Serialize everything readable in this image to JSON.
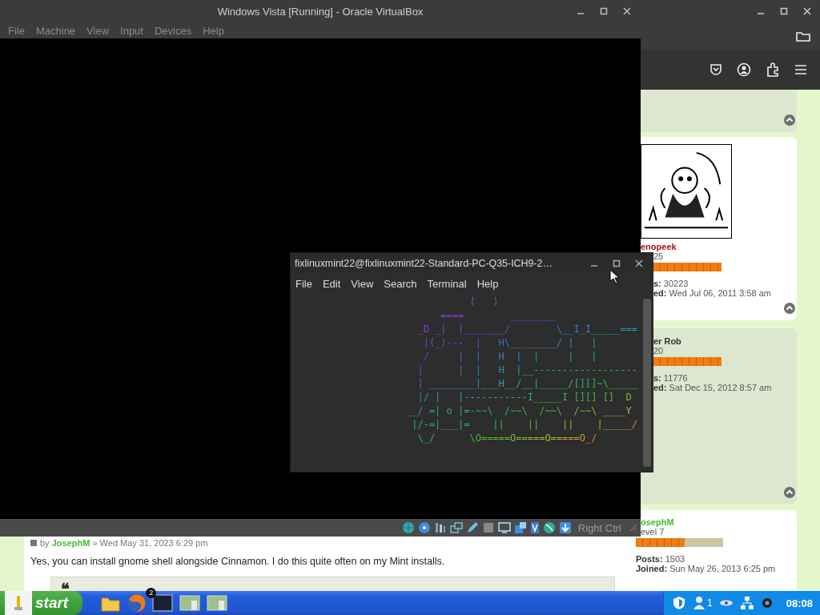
{
  "browser": {
    "profiles": [
      {
        "avatar": true,
        "username": "enopeek",
        "color": "#aa1111",
        "rank": "25",
        "level": 1,
        "posts_label": "s:",
        "posts": "30223",
        "joined_label": "ed:",
        "joined": "Wed Jul 06, 2011 3:58 am"
      },
      {
        "username": "er Rob",
        "color": "#333333",
        "rank": "20",
        "level": 1,
        "posts_label": "s:",
        "posts": "11776",
        "joined_label": "ed:",
        "joined": "Sat Dec 15, 2012 8:57 am"
      },
      {
        "username": "osephM",
        "color": "#44bb33",
        "rank": "evel 7",
        "level": 0.56,
        "posts_label": "Posts:",
        "posts": "1503",
        "joined_label": "Joined:",
        "joined": "Sun May 26, 2013 6:25 pm"
      }
    ],
    "post": {
      "by": "by",
      "author": "JosephM",
      "date": "» Wed May 31, 2023 6:29 pm",
      "text": "Yes, you can install gnome shell alongside Cinnamon. I do this quite often on my Mint installs.",
      "quote_mark": "❝"
    }
  },
  "virtualbox": {
    "title": "Windows Vista [Running] - Oracle VirtualBox",
    "menu": [
      "File",
      "Machine",
      "View",
      "Input",
      "Devices",
      "Help"
    ],
    "status_text": "Right Ctrl"
  },
  "terminal": {
    "title": "fixlinuxmint22@fixlinuxmint22-Standard-PC-Q35-ICH9-2…",
    "menu": [
      "File",
      "Edit",
      "View",
      "Search",
      "Terminal",
      "Help"
    ],
    "output": [
      "           (   )",
      "      ====        ________",
      "  _D _|  |_______/        \\__I_I_____===",
      "   |(_)---  |   H\\________/ |   |",
      "   /     |  |   H  |  |     |   |",
      "  |      |  |   H  |__------------------",
      "  | ________|___H__/__|_____/[][]~\\_____",
      "  |/ |   |-----------I_____I [][] []  D ",
      "__/ =| o |=-~~\\  /~~\\  /~~\\  /~~\\ ____Y",
      " |/-=|___|=    ||    ||    ||    |_____/",
      "  \\_/      \\O=====O=====O=====O_/"
    ]
  },
  "taskbar": {
    "start": "start",
    "terminal_badge": "2",
    "tray_count": "1",
    "clock": "08:08"
  }
}
